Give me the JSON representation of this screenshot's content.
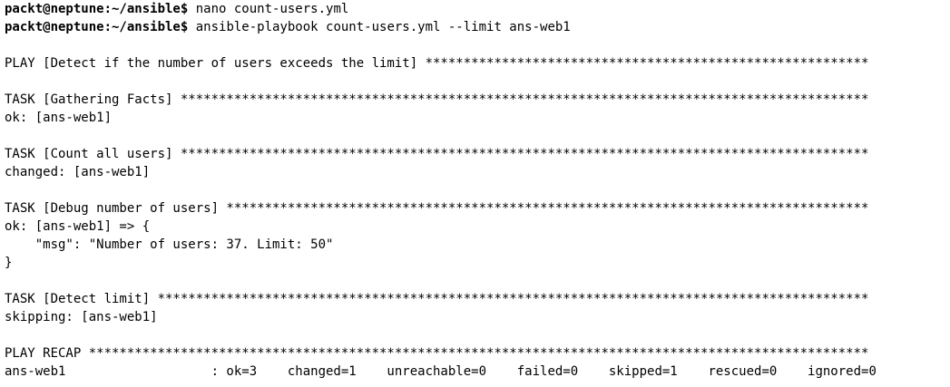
{
  "terminal": {
    "lines": [
      {
        "prompt": "packt@neptune:~/ansible$",
        "text": " nano count-users.yml"
      },
      {
        "prompt": "packt@neptune:~/ansible$",
        "text": " ansible-playbook count-users.yml --limit ans-web1"
      },
      {
        "text": ""
      },
      {
        "text": "PLAY [Detect if the number of users exceeds the limit] **********************************************************"
      },
      {
        "text": ""
      },
      {
        "text": "TASK [Gathering Facts] ******************************************************************************************"
      },
      {
        "text": "ok: [ans-web1]"
      },
      {
        "text": ""
      },
      {
        "text": "TASK [Count all users] ******************************************************************************************"
      },
      {
        "text": "changed: [ans-web1]"
      },
      {
        "text": ""
      },
      {
        "text": "TASK [Debug number of users] ************************************************************************************"
      },
      {
        "text": "ok: [ans-web1] => {"
      },
      {
        "text": "    \"msg\": \"Number of users: 37. Limit: 50\""
      },
      {
        "text": "}"
      },
      {
        "text": ""
      },
      {
        "text": "TASK [Detect limit] *********************************************************************************************"
      },
      {
        "text": "skipping: [ans-web1]"
      },
      {
        "text": ""
      },
      {
        "text": "PLAY RECAP ******************************************************************************************************"
      },
      {
        "text": "ans-web1                   : ok=3    changed=1    unreachable=0    failed=0    skipped=1    rescued=0    ignored=0"
      }
    ]
  }
}
